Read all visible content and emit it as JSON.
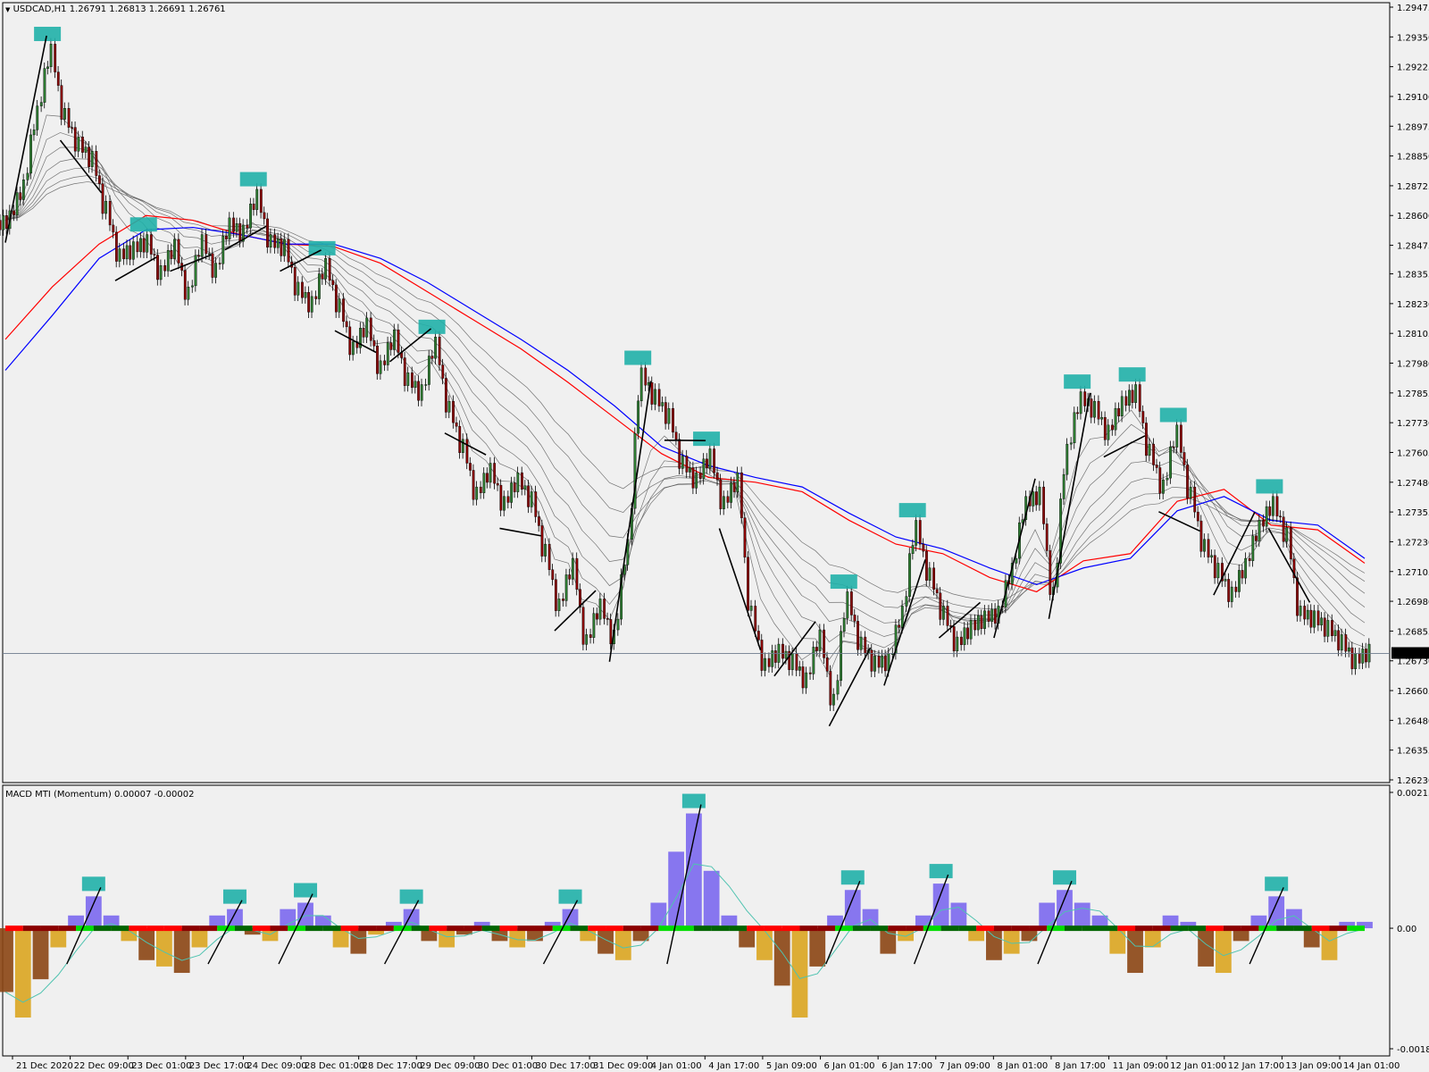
{
  "main_header": {
    "symbol": "USDCAD,H1",
    "ohlc": "1.26791 1.26813 1.26691 1.26761"
  },
  "sub_header": {
    "name": "MACD MTI (Momentum)",
    "values": "0.00007 -0.00002"
  },
  "chart_data": [
    {
      "type": "candlestick",
      "title": "USDCAD,H1 1.26791 1.26813 1.26691 1.26761",
      "ylim": [
        1.2623,
        1.29475
      ],
      "y_ticks": [
        "1.29475",
        "1.29350",
        "1.29225",
        "1.29100",
        "1.28975",
        "1.28850",
        "1.28725",
        "1.28600",
        "1.28475",
        "1.28355",
        "1.28230",
        "1.28105",
        "1.27980",
        "1.27855",
        "1.27730",
        "1.27605",
        "1.27480",
        "1.27355",
        "1.27230",
        "1.27105",
        "1.26980",
        "1.26855",
        "1.26730",
        "1.26605",
        "1.26480",
        "1.26355",
        "1.26230"
      ],
      "current_price": "1.26761",
      "close_series": [
        1.2858,
        1.2871,
        1.2902,
        1.2928,
        1.2901,
        1.2889,
        1.2883,
        1.2862,
        1.2842,
        1.2845,
        1.2848,
        1.2835,
        1.2846,
        1.2826,
        1.2848,
        1.2836,
        1.2855,
        1.2852,
        1.2867,
        1.2848,
        1.2846,
        1.2828,
        1.2822,
        1.2838,
        1.2821,
        1.2803,
        1.2813,
        1.2795,
        1.2808,
        1.279,
        1.2785,
        1.2805,
        1.2778,
        1.2762,
        1.2742,
        1.2752,
        1.2738,
        1.2748,
        1.274,
        1.2718,
        1.2695,
        1.2712,
        1.268,
        1.2695,
        1.2682,
        1.272,
        1.2792,
        1.2783,
        1.2775,
        1.2755,
        1.2748,
        1.2758,
        1.2738,
        1.2748,
        1.2692,
        1.267,
        1.2676,
        1.2672,
        1.2664,
        1.2682,
        1.2655,
        1.2698,
        1.2679,
        1.2671,
        1.2672,
        1.2692,
        1.2728,
        1.2708,
        1.2692,
        1.2679,
        1.2686,
        1.269,
        1.2692,
        1.271,
        1.2738,
        1.2742,
        1.27,
        1.276,
        1.2782,
        1.2778,
        1.2768,
        1.278,
        1.2785,
        1.276,
        1.2745,
        1.2768,
        1.2742,
        1.272,
        1.271,
        1.27,
        1.2712,
        1.2728,
        1.2738,
        1.2725,
        1.2692,
        1.269,
        1.2686,
        1.268,
        1.2672,
        1.2676
      ],
      "ema_bands": [
        "gray-1",
        "gray-2",
        "gray-3",
        "gray-4",
        "gray-5",
        "gray-6",
        "gray-7"
      ],
      "ema_red": [
        1.2808,
        1.283,
        1.2848,
        1.286,
        1.2858,
        1.2852,
        1.2848,
        1.2847,
        1.284,
        1.2828,
        1.2816,
        1.2804,
        1.279,
        1.2775,
        1.276,
        1.275,
        1.2748,
        1.2744,
        1.2732,
        1.2722,
        1.2718,
        1.2708,
        1.2702,
        1.2715,
        1.2718,
        1.274,
        1.2745,
        1.273,
        1.2728,
        1.2714
      ],
      "ema_blue": [
        1.2795,
        1.2818,
        1.2842,
        1.2854,
        1.2855,
        1.2852,
        1.2848,
        1.2848,
        1.2842,
        1.2832,
        1.282,
        1.2808,
        1.2795,
        1.278,
        1.2763,
        1.2755,
        1.275,
        1.2746,
        1.2735,
        1.2725,
        1.272,
        1.2712,
        1.2705,
        1.2712,
        1.2716,
        1.2736,
        1.2742,
        1.2732,
        1.273,
        1.2716
      ],
      "box_color": "#20b0a8",
      "up_color": "#2e7d32",
      "down_color": "#8b0000"
    },
    {
      "type": "bar",
      "title": "MACD MTI (Momentum) 0.00007 -0.00002",
      "ylim": [
        -0.00189,
        0.00213
      ],
      "y_ticks": [
        "0.00213",
        "0.00",
        "-0.00189"
      ],
      "histogram": [
        -0.001,
        -0.0014,
        -0.0008,
        -0.0003,
        0.0002,
        0.0005,
        0.0002,
        -0.0002,
        -0.0005,
        -0.0006,
        -0.0007,
        -0.0003,
        0.0002,
        0.0003,
        -0.0001,
        -0.0002,
        0.0003,
        0.0004,
        0.0002,
        -0.0003,
        -0.0004,
        -0.0001,
        0.0001,
        0.0003,
        -0.0002,
        -0.0003,
        -0.0001,
        0.0001,
        -0.0002,
        -0.0003,
        -0.0002,
        0.0001,
        0.0003,
        -0.0002,
        -0.0004,
        -0.0005,
        -0.0002,
        0.0004,
        0.0012,
        0.0018,
        0.0009,
        0.0002,
        -0.0003,
        -0.0005,
        -0.0009,
        -0.0014,
        -0.0006,
        0.0002,
        0.0006,
        0.0003,
        -0.0004,
        -0.0002,
        0.0002,
        0.0007,
        0.0004,
        -0.0002,
        -0.0005,
        -0.0004,
        -0.0002,
        0.0004,
        0.0006,
        0.0004,
        0.0002,
        -0.0004,
        -0.0007,
        -0.0003,
        0.0002,
        0.0001,
        -0.0006,
        -0.0007,
        -0.0002,
        0.0002,
        0.0005,
        0.0003,
        -0.0003,
        -0.0005,
        0.0001,
        0.0001
      ],
      "zero_line_colors": [
        "#ff0000",
        "#00dd00",
        "#006400",
        "#8b0000"
      ],
      "pos_color": "#7b68ee",
      "neg_color_a": "#daa520",
      "neg_color_b": "#8b4513"
    }
  ],
  "x_axis": {
    "labels": [
      "21 Dec 2020",
      "22 Dec 09:00",
      "23 Dec 01:00",
      "23 Dec 17:00",
      "24 Dec 09:00",
      "28 Dec 01:00",
      "28 Dec 17:00",
      "29 Dec 09:00",
      "30 Dec 01:00",
      "30 Dec 17:00",
      "31 Dec 09:00",
      "4 Jan 01:00",
      "4 Jan 17:00",
      "5 Jan 09:00",
      "6 Jan 01:00",
      "6 Jan 17:00",
      "7 Jan 09:00",
      "8 Jan 01:00",
      "8 Jan 17:00",
      "11 Jan 09:00",
      "12 Jan 01:00",
      "12 Jan 17:00",
      "13 Jan 09:00",
      "14 Jan 01:00"
    ]
  }
}
